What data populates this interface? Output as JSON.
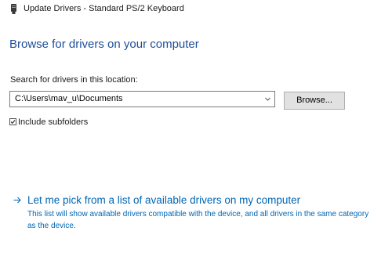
{
  "window": {
    "title": "Update Drivers - Standard PS/2 Keyboard",
    "icon": "keyboard-device-icon"
  },
  "page": {
    "heading": "Browse for drivers on your computer",
    "search_label": "Search for drivers in this location:",
    "path_value": "C:\\Users\\mav_u\\Documents",
    "browse_label": "Browse...",
    "include_subfolders": {
      "label": "Include subfolders",
      "checked": true
    },
    "pick_link": {
      "label": "Let me pick from a list of available drivers on my computer",
      "description": "This list will show available drivers compatible with the device, and all drivers in the same category as the device."
    }
  },
  "colors": {
    "heading": "#1f4e9a",
    "link": "#0066b4",
    "button_face": "#e1e1e1"
  }
}
